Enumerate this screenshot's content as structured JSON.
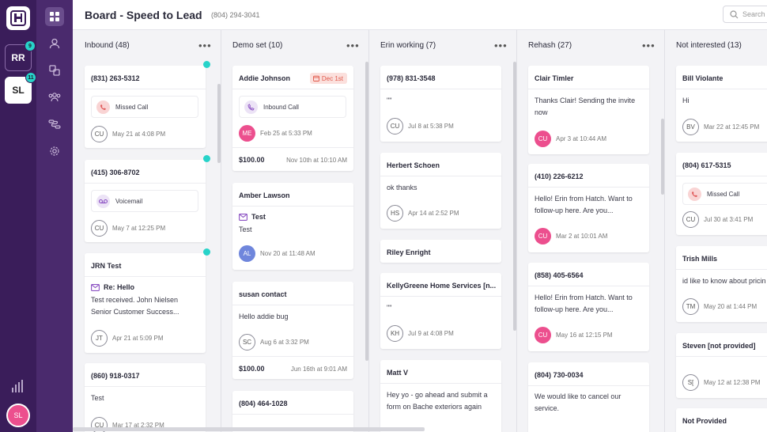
{
  "workspaces": [
    {
      "initials": "RR",
      "badge": "9"
    },
    {
      "initials": "SL",
      "badge": "11"
    }
  ],
  "user": {
    "initials": "SL"
  },
  "nav": [
    "grid-icon",
    "person-icon",
    "layers-icon",
    "people-icon",
    "flow-icon",
    "gear-icon"
  ],
  "header": {
    "title": "Board - Speed to Lead",
    "phone": "(804) 294-3041",
    "search_placeholder": "Search"
  },
  "columns": [
    {
      "title": "Inbound (48)",
      "cards": [
        {
          "title": "(831) 263-5312",
          "chip": "Missed Call",
          "avatar": "CU",
          "time": "May 21 at 4:08 PM"
        },
        {
          "title": "(415) 306-8702",
          "chip": "Voicemail",
          "avatar": "CU",
          "time": "May 7 at 12:25 PM"
        },
        {
          "title": "JRN Test",
          "subject": "Re: Hello",
          "line1": "Test received. John Nielsen",
          "line2": "Senior Customer Success...",
          "avatar": "JT",
          "time": "Apr 21 at 5:09 PM"
        },
        {
          "title": "(860) 918-0317",
          "text": "Test",
          "avatar": "CU",
          "time": "Mar 17 at 2:32 PM"
        }
      ]
    },
    {
      "title": "Demo set (10)",
      "cards": [
        {
          "title": "Addie Johnson",
          "tag": "Dec 1st",
          "chip": "Inbound Call",
          "avatar": "ME",
          "time": "Feb 25 at 5:33 PM",
          "amount": "$100.00",
          "amount_date": "Nov 10th at 10:10 AM"
        },
        {
          "title": "Amber Lawson",
          "subject": "Test",
          "text": "Test",
          "avatar": "AL",
          "time": "Nov 20 at 11:48 AM"
        },
        {
          "title": "susan contact",
          "text": "Hello addie bug",
          "avatar": "SC",
          "time": "Aug 6 at 3:32 PM",
          "amount": "$100.00",
          "amount_date": "Jun 16th at 9:01 AM"
        },
        {
          "title": "(804) 464-1028"
        }
      ]
    },
    {
      "title": "Erin working (7)",
      "cards": [
        {
          "title": "(978) 831-3548",
          "text": "\"\"",
          "avatar": "CU",
          "time": "Jul 8 at 5:38 PM"
        },
        {
          "title": "Herbert Schoen",
          "text": "ok thanks",
          "avatar": "HS",
          "time": "Apr 14 at 2:52 PM"
        },
        {
          "title": "Riley Enright"
        },
        {
          "title": "KellyGreene Home Services [n...",
          "text": "\"\"",
          "avatar": "KH",
          "time": "Jul 9 at 4:08 PM"
        },
        {
          "title": "Matt V",
          "line1": "Hey yo - go ahead and submit a",
          "line2": "form on Bache exteriors again"
        }
      ]
    },
    {
      "title": "Rehash (27)",
      "cards": [
        {
          "title": "Clair Timler",
          "line1": "Thanks Clair! Sending the invite",
          "line2": "now",
          "avatar": "CU",
          "time": "Apr 3 at 10:44 AM"
        },
        {
          "title": "(410) 226-6212",
          "line1": "Hello! Erin from Hatch. Want to",
          "line2": "follow-up here. Are you...",
          "avatar": "CU",
          "time": "Mar 2 at 10:01 AM"
        },
        {
          "title": "(858) 405-6564",
          "line1": "Hello! Erin from Hatch. Want to",
          "line2": "follow-up here. Are you...",
          "avatar": "CU",
          "time": "May 16 at 12:15 PM"
        },
        {
          "title": "(804) 730-0034",
          "line1": "We would like to cancel our",
          "line2": "service."
        }
      ]
    },
    {
      "title": "Not interested (13)",
      "cards": [
        {
          "title": "Bill Violante",
          "text": "Hi",
          "avatar": "BV",
          "time": "Mar 22 at 12:45 PM"
        },
        {
          "title": "(804) 617-5315",
          "chip": "Missed Call",
          "avatar": "CU",
          "time": "Jul 30 at 3:41 PM"
        },
        {
          "title": "Trish Mills",
          "text": "id like to know about pricin",
          "avatar": "TM",
          "time": "May 20 at 1:44 PM"
        },
        {
          "title": "Steven [not provided]",
          "avatar": "S[",
          "time": "May 12 at 12:38 PM"
        },
        {
          "title": "Not Provided"
        }
      ]
    }
  ]
}
